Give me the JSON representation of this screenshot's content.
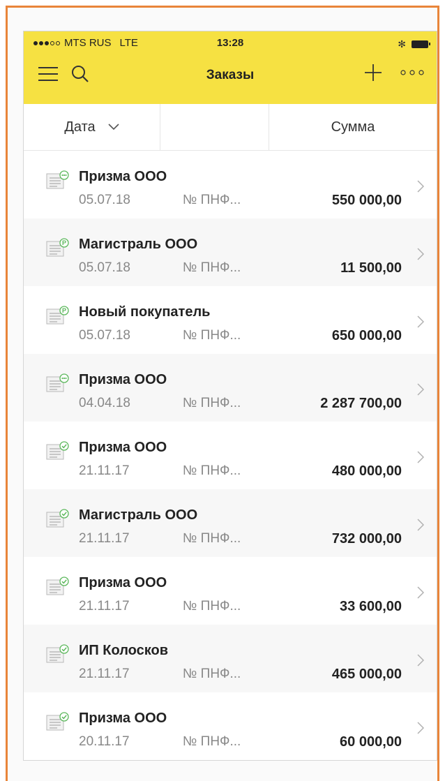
{
  "status": {
    "carrier": "MTS RUS",
    "network": "LTE",
    "time": "13:28",
    "bluetooth": "✻"
  },
  "nav": {
    "title": "Заказы",
    "menu_icon": "menu-icon",
    "search_icon": "search-icon",
    "add_icon": "plus-icon",
    "more_icon": "more-icon"
  },
  "columns": {
    "date": "Дата",
    "sum": "Сумма"
  },
  "colors": {
    "accent_yellow": "#f6e142",
    "frame_orange": "#e9853a",
    "status_green": "#5cb85c"
  },
  "orders": [
    {
      "name": "Призма ООО",
      "date": "05.07.18",
      "number": "№ ПНФ...",
      "amount": "550 000,00",
      "status_icon": "in-progress-icon"
    },
    {
      "name": "Магистраль ООО",
      "date": "05.07.18",
      "number": "№ ПНФ...",
      "amount": "11 500,00",
      "status_icon": "approved-icon"
    },
    {
      "name": "Новый покупатель",
      "date": "05.07.18",
      "number": "№ ПНФ...",
      "amount": "650 000,00",
      "status_icon": "approved-icon"
    },
    {
      "name": "Призма ООО",
      "date": "04.04.18",
      "number": "№ ПНФ...",
      "amount": "2 287 700,00",
      "status_icon": "in-progress-icon"
    },
    {
      "name": "Призма ООО",
      "date": "21.11.17",
      "number": "№ ПНФ...",
      "amount": "480 000,00",
      "status_icon": "done-icon"
    },
    {
      "name": "Магистраль ООО",
      "date": "21.11.17",
      "number": "№ ПНФ...",
      "amount": "732 000,00",
      "status_icon": "done-icon"
    },
    {
      "name": "Призма ООО",
      "date": "21.11.17",
      "number": "№ ПНФ...",
      "amount": "33 600,00",
      "status_icon": "done-icon"
    },
    {
      "name": "ИП Колосков",
      "date": "21.11.17",
      "number": "№ ПНФ...",
      "amount": "465 000,00",
      "status_icon": "done-icon"
    },
    {
      "name": "Призма ООО",
      "date": "20.11.17",
      "number": "№ ПНФ...",
      "amount": "60 000,00",
      "status_icon": "done-icon"
    }
  ]
}
